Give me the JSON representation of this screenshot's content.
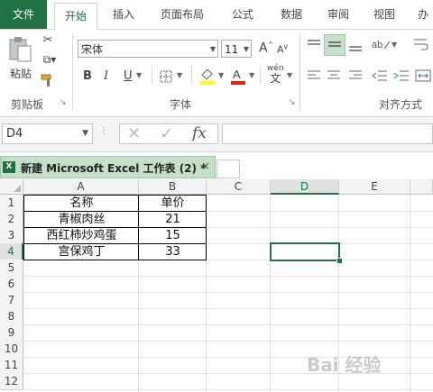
{
  "tabs": [
    "文件",
    "开始",
    "插入",
    "页面布局",
    "公式",
    "数据",
    "审阅",
    "视图",
    "办"
  ],
  "ribbon": {
    "paste_label": "粘贴",
    "font_name": "宋体",
    "font_size": "11",
    "groups": {
      "clipboard": "剪贴板",
      "font": "字体",
      "align": "对齐方式"
    },
    "bold": "B",
    "italic": "I",
    "underline": "U",
    "grow": "A",
    "shrink": "A",
    "wen": "wén"
  },
  "formula": {
    "name_box": "D4",
    "fx": "fx"
  },
  "workbook": {
    "title": "新建 Microsoft Excel 工作表 (2) *"
  },
  "columns": [
    "A",
    "B",
    "C",
    "D",
    "E"
  ],
  "rows": [
    "1",
    "2",
    "3",
    "4",
    "5",
    "6",
    "7",
    "8",
    "9",
    "10",
    "11",
    "12"
  ],
  "table": {
    "headers": [
      "名称",
      "单价"
    ],
    "rows": [
      [
        "青椒肉丝",
        "21"
      ],
      [
        "西红柿炒鸡蛋",
        "15"
      ],
      [
        "宫保鸡丁",
        "33"
      ]
    ]
  },
  "watermark": "Bai 经验"
}
